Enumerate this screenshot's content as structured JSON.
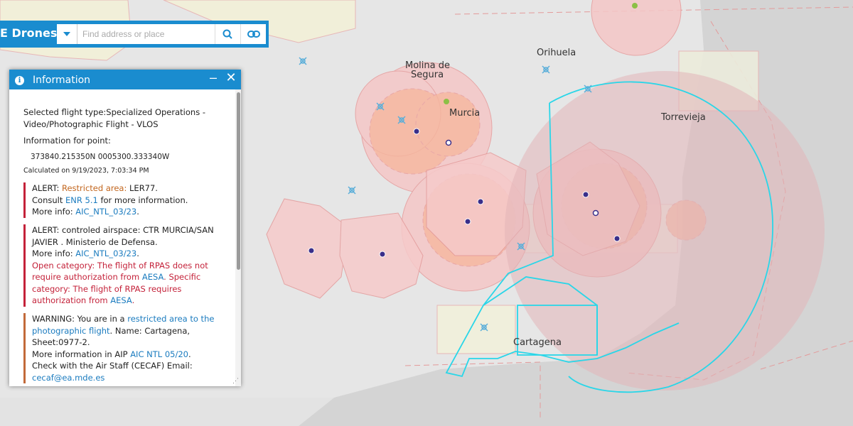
{
  "app": {
    "title": "E Drones"
  },
  "search": {
    "placeholder": "Find address or place"
  },
  "icons": {
    "dropdown": "chevron-down-icon",
    "search": "search-icon",
    "link": "link-icon",
    "info": "info-icon",
    "minimize": "minimize-icon",
    "close": "close-icon",
    "resize": "resize-handle-icon",
    "aerodrome": "aerodrome-icon"
  },
  "colors": {
    "accent": "#1a8ccf",
    "alert_red": "#c4223a",
    "alert_orange": "#c26a3a",
    "zone_pink": "#f2b8b8",
    "zone_outline": "#29d6e8",
    "point": "#3a2f8a"
  },
  "map": {
    "places": [
      "Molina de",
      "Segura",
      "Orihuela",
      "Murcia",
      "Torrevieja",
      "Cartagena"
    ]
  },
  "panel": {
    "title": "Information",
    "minimize_label": "–",
    "close_label": "✕",
    "flight_type_line1": "Selected flight type:Specialized Operations -",
    "flight_type_line2": "Video/Photographic Flight - VLOS",
    "point_label": "Information for point:",
    "coordinates": "373840.215350N 0005300.333340W",
    "calculated": "Calculated on 9/19/2023, 7:03:34 PM",
    "alert1": {
      "l1_prefix": "ALERT: ",
      "l1_link": "Restricted area:",
      "l1_suffix": " LER77.",
      "l2_prefix": "Consult ",
      "l2_link": "ENR 5.1",
      "l2_suffix": " for more information.",
      "l3_prefix": "More info: ",
      "l3_link": "AIC_NTL_03/23",
      "l3_suffix": "."
    },
    "alert2": {
      "l1": "ALERT: controled airspace: CTR MURCIA/SAN",
      "l2": "JAVIER . Ministerio de Defensa.",
      "l3_prefix": "More info: ",
      "l3_link": "AIC_NTL_03/23",
      "l3_suffix": ".",
      "l4": "Open category: The flight of RPAS does not",
      "l5_prefix": "require authorization from ",
      "l5_link": "AESA",
      "l5_suffix": ". Specific",
      "l6": "category: The flight of RPAS requires",
      "l7_prefix": "authorization from ",
      "l7_link": "AESA",
      "l7_suffix": "."
    },
    "warning": {
      "l1_prefix": "WARNING: You are in a ",
      "l1_link": "restricted area to the",
      "l2_link": "photographic flight",
      "l2_suffix": ". Name: Cartagena,",
      "l3": "Sheet:0977-2.",
      "l4_prefix": "More information in AIP ",
      "l4_link": "AIC NTL 05/20",
      "l4_suffix": ".",
      "l5": "Check with the Air Staff (CECAF) Email:",
      "l6_link": "cecaf@ea.mde.es"
    }
  }
}
